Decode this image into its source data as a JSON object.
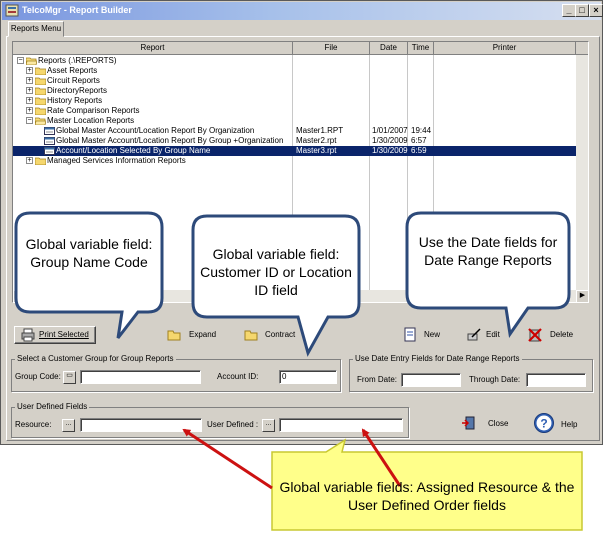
{
  "window": {
    "title": "TelcoMgr - Report Builder",
    "controls": {
      "minimize": "_",
      "maximize": "□",
      "close": "×"
    }
  },
  "tab": {
    "label": "Reports Menu"
  },
  "grid": {
    "columns": [
      "Report",
      "File",
      "Date",
      "Time",
      "Printer"
    ],
    "rows": [
      {
        "indent": 0,
        "toggle": "−",
        "icon": "folder-open-icon",
        "name": "Reports (.\\REPORTS)",
        "file": "",
        "date": "",
        "time": "",
        "selected": false
      },
      {
        "indent": 1,
        "toggle": "+",
        "icon": "folder-icon",
        "name": "Asset Reports",
        "file": "",
        "date": "",
        "time": "",
        "selected": false
      },
      {
        "indent": 1,
        "toggle": "+",
        "icon": "folder-icon",
        "name": "Circuit Reports",
        "file": "",
        "date": "",
        "time": "",
        "selected": false
      },
      {
        "indent": 1,
        "toggle": "+",
        "icon": "folder-icon",
        "name": "DirectoryReports",
        "file": "",
        "date": "",
        "time": "",
        "selected": false
      },
      {
        "indent": 1,
        "toggle": "+",
        "icon": "folder-icon",
        "name": "History Reports",
        "file": "",
        "date": "",
        "time": "",
        "selected": false
      },
      {
        "indent": 1,
        "toggle": "+",
        "icon": "folder-icon",
        "name": "Rate Comparison Reports",
        "file": "",
        "date": "",
        "time": "",
        "selected": false
      },
      {
        "indent": 1,
        "toggle": "−",
        "icon": "folder-open-icon",
        "name": "Master Location Reports",
        "file": "",
        "date": "",
        "time": "",
        "selected": false
      },
      {
        "indent": 2,
        "toggle": "",
        "icon": "report-icon",
        "name": "Global Master Account/Location Report By Organization",
        "file": "Master1.RPT",
        "date": "1/01/2007",
        "time": "19:44",
        "selected": false
      },
      {
        "indent": 2,
        "toggle": "",
        "icon": "report-icon",
        "name": "Global Master Account/Location Report By Group +Organization",
        "file": "Master2.rpt",
        "date": "1/30/2009",
        "time": "6:57",
        "selected": false
      },
      {
        "indent": 2,
        "toggle": "",
        "icon": "report-icon",
        "name": "Account/Location Selected By Group Name",
        "file": "Master3.rpt",
        "date": "1/30/2009",
        "time": "6:59",
        "selected": true
      },
      {
        "indent": 1,
        "toggle": "+",
        "icon": "folder-icon",
        "name": "Managed Services Information Reports",
        "file": "",
        "date": "",
        "time": "",
        "selected": false
      }
    ]
  },
  "toolbar": {
    "print_selected": "Print Selected",
    "expand": "Expand",
    "contract": "Contract",
    "new": "New",
    "edit": "Edit",
    "delete": "Delete"
  },
  "customer_group": {
    "legend": "Select a Customer Group for Group Reports",
    "group_code_label": "Group Code:",
    "group_code_value": "",
    "account_id_label": "Account ID:",
    "account_id_value": "0"
  },
  "date_range": {
    "legend": "Use Date Entry Fields for Date Range Reports",
    "from_label": "From Date:",
    "from_value": "",
    "through_label": "Through Date:",
    "through_value": ""
  },
  "user_defined": {
    "legend": "User Defined Fields",
    "resource_label": "Resource:",
    "resource_value": "",
    "user_defined_label": "User Defined :",
    "user_defined_value": "",
    "ellipsis": "..."
  },
  "actions": {
    "close": "Close",
    "help": "Help"
  },
  "callouts": {
    "group_name": "Global variable field: Group Name Code",
    "customer_id": "Global variable field: Customer ID or Location ID field",
    "date_fields": "Use the Date fields for Date Range Reports",
    "bottom": "Global variable fields: Assigned Resource & the User Defined Order fields"
  },
  "colors": {
    "selection": "#0a246a",
    "callout_blue_fill": "#ffffff",
    "callout_blue_border": "#2d4a7a",
    "callout_yellow_fill": "#ffff8a",
    "callout_yellow_border": "#c8c832",
    "arrow": "#cc1111",
    "window_face": "#d4d0c8"
  }
}
